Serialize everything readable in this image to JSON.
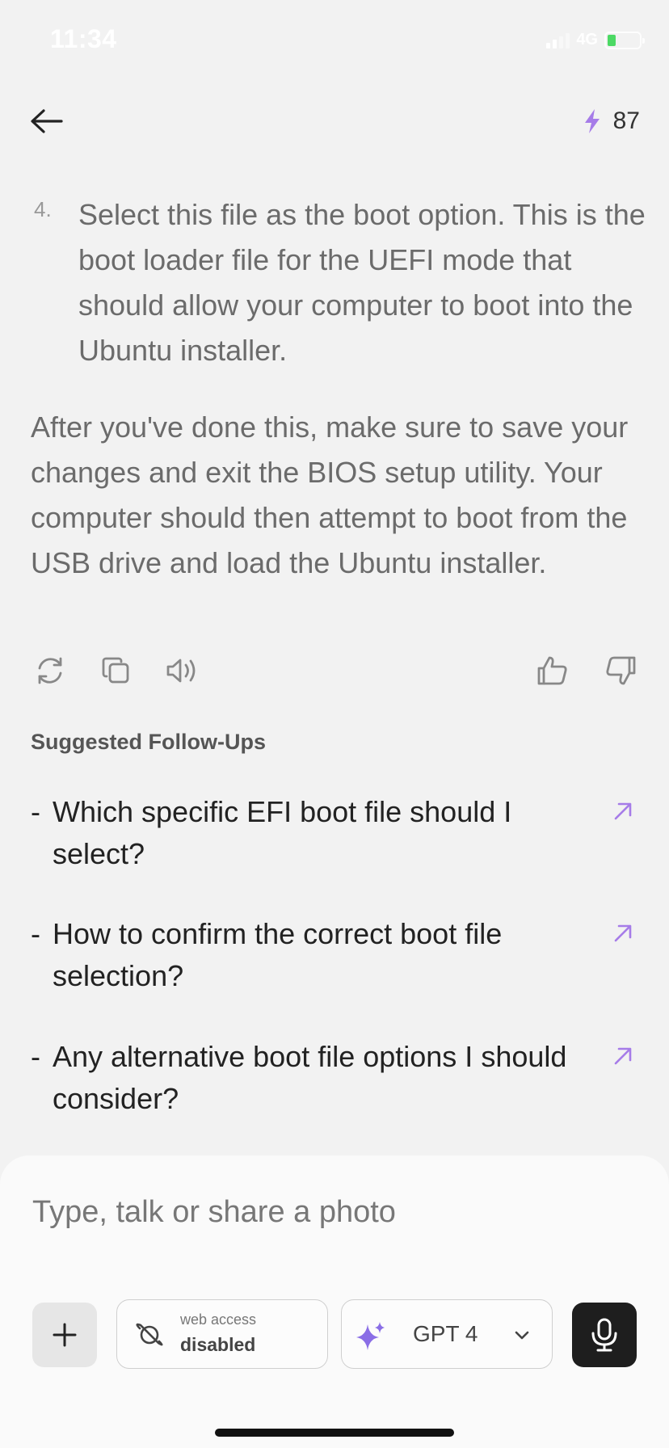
{
  "status_bar": {
    "time": "11:34",
    "network": "4G",
    "battery_level": 0.25,
    "battery_color": "#4cd964"
  },
  "header": {
    "back_icon": "arrow-left-icon",
    "credits_icon": "lightning-bolt-icon",
    "credits_value": "87",
    "accent_color": "#a67ce8"
  },
  "message": {
    "step_number": "4.",
    "step_text": "Select this file as the boot option. This is the boot loader file for the UEFI mode that should allow your computer to boot into the Ubuntu installer.",
    "paragraph": "After you've done this, make sure to save your changes and exit the BIOS setup utility. Your computer should then attempt to boot from the USB drive and load the Ubuntu installer."
  },
  "actions": {
    "icons": [
      "regenerate-icon",
      "copy-icon",
      "speaker-icon",
      "thumbs-up-icon",
      "thumbs-down-icon"
    ]
  },
  "suggested": {
    "title": "Suggested Follow-Ups",
    "items": [
      {
        "dash": "-",
        "text": "Which specific EFI boot file should I select?"
      },
      {
        "dash": "-",
        "text": "How to confirm the correct boot file selection?"
      },
      {
        "dash": "-",
        "text": "Any alternative boot file options I should consider?"
      }
    ]
  },
  "composer": {
    "placeholder": "Type, talk or share a photo",
    "web_access_small": "web access",
    "web_access_state": "disabled",
    "model_label": "GPT 4"
  }
}
